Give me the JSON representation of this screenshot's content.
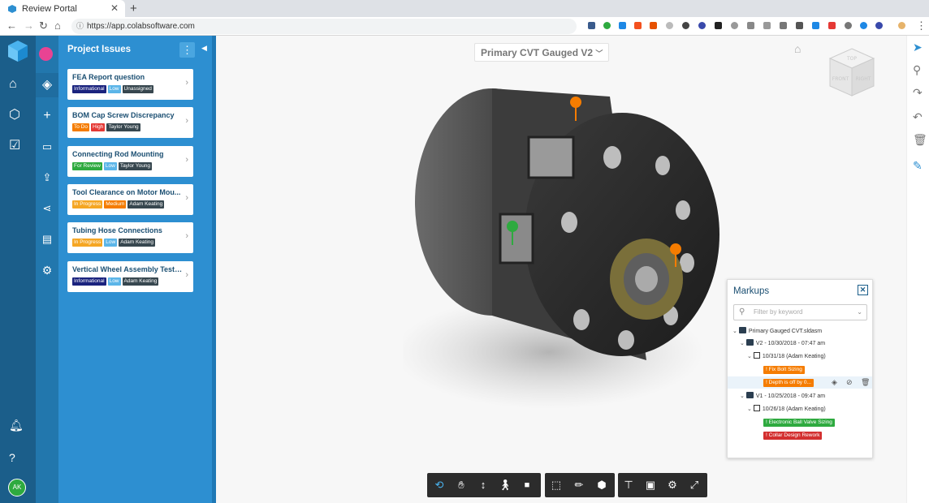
{
  "browser": {
    "tab_title": "Review Portal",
    "url": "https://app.colabsoftware.com"
  },
  "panel": {
    "title": "Project Issues"
  },
  "issues": [
    {
      "title": "FEA Report question",
      "tags": [
        {
          "t": "Informational",
          "c": "#1a237e"
        },
        {
          "t": "Low",
          "c": "#5bb5e8"
        },
        {
          "t": "Unassigned",
          "c": "#37474f"
        }
      ]
    },
    {
      "title": "BOM Cap Screw Discrepancy",
      "tags": [
        {
          "t": "To Do",
          "c": "#f57c00"
        },
        {
          "t": "High",
          "c": "#e53935"
        },
        {
          "t": "Taylor Young",
          "c": "#37474f"
        }
      ]
    },
    {
      "title": "Connecting Rod Mounting",
      "tags": [
        {
          "t": "For Review",
          "c": "#2eaa3f"
        },
        {
          "t": "Low",
          "c": "#5bb5e8"
        },
        {
          "t": "Taylor Young",
          "c": "#37474f"
        }
      ]
    },
    {
      "title": "Tool Clearance on Motor Mou...",
      "tags": [
        {
          "t": "In Progress",
          "c": "#f5a623"
        },
        {
          "t": "Medium",
          "c": "#f57c00"
        },
        {
          "t": "Adam Keating",
          "c": "#37474f"
        }
      ]
    },
    {
      "title": "Tubing Hose Connections",
      "tags": [
        {
          "t": "In Progress",
          "c": "#f5a623"
        },
        {
          "t": "Low",
          "c": "#5bb5e8"
        },
        {
          "t": "Adam Keating",
          "c": "#37474f"
        }
      ]
    },
    {
      "title": "Vertical Wheel Assembly Testi...",
      "tags": [
        {
          "t": "Informational",
          "c": "#1a237e"
        },
        {
          "t": "Low",
          "c": "#5bb5e8"
        },
        {
          "t": "Adam Keating",
          "c": "#37474f"
        }
      ]
    }
  ],
  "viewer": {
    "model_title": "Primary CVT Gauged V2",
    "cube_faces": [
      "TOP",
      "FRONT",
      "RIGHT"
    ]
  },
  "markups": {
    "title": "Markups",
    "filter_placeholder": "Filter by keyword",
    "root": "Primary Gauged CVT.sldasm",
    "v2": "V2 - 10/30/2018 - 07:47 am",
    "v2_author": "10/31/18 (Adam Keating)",
    "v2_items": [
      "Fix Bolt Sizing",
      "Depth is off by 0..."
    ],
    "v1": "V1 - 10/25/2018 - 09:47 am",
    "v1_author": "10/26/18 (Adam Keating)",
    "v1_items": [
      "Electronic Ball Valve Sizing",
      "Collar Design Rework"
    ]
  },
  "user": {
    "initials": "AK"
  }
}
